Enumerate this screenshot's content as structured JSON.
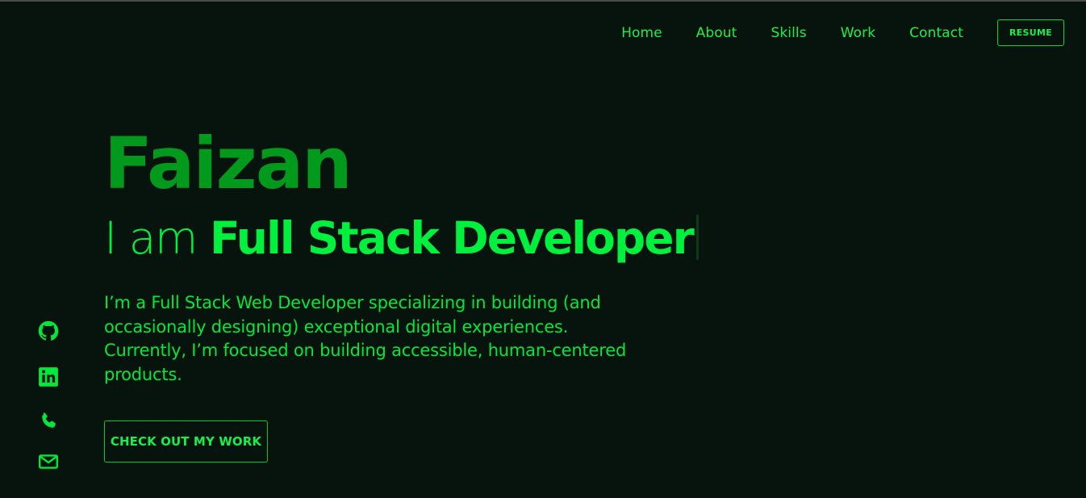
{
  "nav": {
    "items": [
      "Home",
      "About",
      "Skills",
      "Work",
      "Contact"
    ],
    "resume_label": "RESUME"
  },
  "hero": {
    "name": "Faizan",
    "tagline_prefix": "I am ",
    "tagline_role": "Full Stack Developer",
    "intro": "I’m a Full Stack Web Developer specializing in building (and occasionally designing) exceptional digital experiences. Currently, I’m focused on building accessible, human-centered products.",
    "cta_label": "CHECK OUT MY WORK"
  },
  "socials": [
    {
      "icon": "github-icon"
    },
    {
      "icon": "linkedin-icon"
    },
    {
      "icon": "phone-icon"
    },
    {
      "icon": "mail-icon"
    }
  ],
  "colors": {
    "background": "#07140d",
    "accent": "#00e83a",
    "name": "#029a1d"
  }
}
